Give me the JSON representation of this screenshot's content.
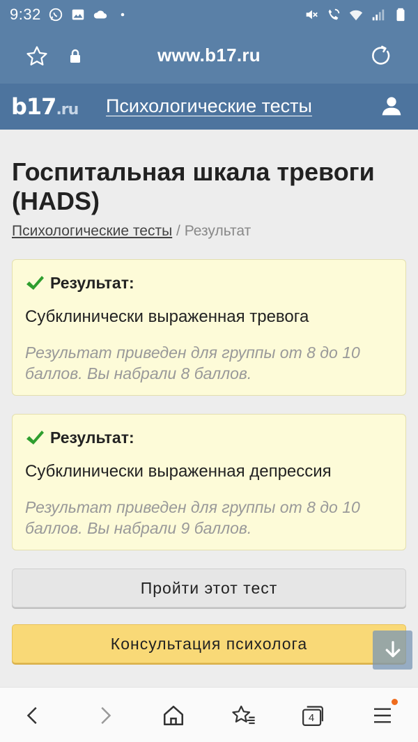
{
  "status_bar": {
    "time": "9:32",
    "left_icons": [
      "whatsapp-icon",
      "image-icon",
      "cloud-icon",
      "dot-icon"
    ],
    "right_icons": [
      "mute-icon",
      "wifi-call-icon",
      "wifi-icon",
      "signal-icon",
      "battery-icon"
    ]
  },
  "browser": {
    "url": "www.b17.ru",
    "tabs_count": "4"
  },
  "site": {
    "logo_main": "b17",
    "logo_suffix": ".ru",
    "nav_link": "Психологические тесты"
  },
  "page": {
    "title": "Госпитальная шкала тревоги (HADS)",
    "breadcrumb": {
      "link": "Психологические тесты",
      "separator": " / ",
      "current": "Результат"
    }
  },
  "results": [
    {
      "heading": "Результат:",
      "text": "Субклинически выраженная тревога",
      "note": "Результат приведен для группы от 8 до 10 баллов. Вы набрали 8 баллов."
    },
    {
      "heading": "Результат:",
      "text": "Субклинически выраженная депрессия",
      "note": "Результат приведен для группы от 8 до 10 баллов. Вы набрали 9 баллов."
    }
  ],
  "buttons": {
    "take_test": "Пройти этот тест",
    "consult": "Консультация психолога"
  },
  "colors": {
    "header_blue": "#5a80a7",
    "site_blue": "#4d749e",
    "card_bg": "#fdfbd8",
    "check_green": "#2e9e2e",
    "consult_yellow": "#f9d977"
  }
}
